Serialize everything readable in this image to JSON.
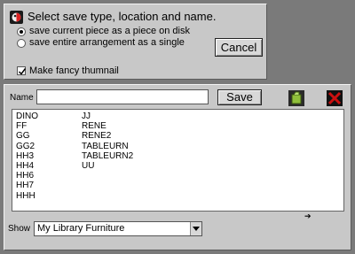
{
  "dialog": {
    "prompt": "Select save type, location and name.",
    "options": [
      {
        "label": "save current piece as a piece on disk",
        "selected": true
      },
      {
        "label": "save entire arrangement as a single",
        "selected": false
      }
    ],
    "cancel_label": "Cancel",
    "thumbnail_label": "Make fancy thumnail",
    "thumbnail_checked": true
  },
  "save_area": {
    "name_label": "Name",
    "name_value": "",
    "save_label": "Save"
  },
  "files": {
    "col_a": [
      "DINO",
      "FF",
      "GG",
      "GG2",
      "HH3",
      "HH4",
      "HH6",
      "HH7",
      "HHH"
    ],
    "col_b": [
      "JJ",
      "RENE",
      "RENE2",
      "TABLEURN",
      "TABLEURN2",
      "UU"
    ]
  },
  "scroll_arrow": "➔",
  "show": {
    "label": "Show",
    "selected": "My Library Furniture"
  },
  "colors": {
    "panel": "#c8c8c8",
    "background": "#7a7a7a",
    "delete_icon": "#cc1010",
    "new_icon": "#5a8a1a"
  }
}
